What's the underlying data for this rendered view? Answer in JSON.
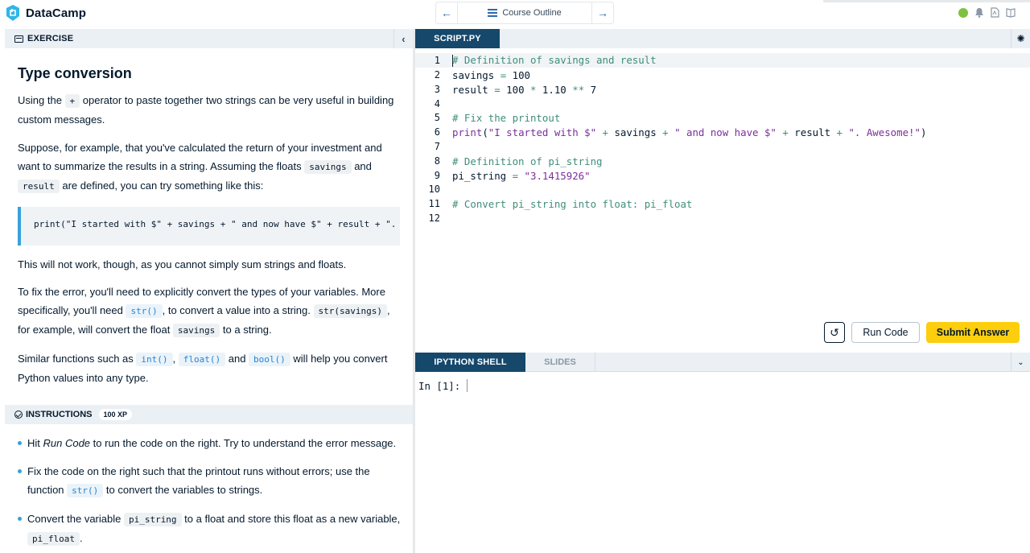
{
  "app": {
    "name": "DataCamp"
  },
  "nav": {
    "prev": "←",
    "outline": "Course Outline",
    "next": "→"
  },
  "exercise": {
    "header": "EXERCISE",
    "title": "Type conversion",
    "p1_a": "Using the ",
    "p1_code": "+",
    "p1_b": " operator to paste together two strings can be very useful in building custom messages.",
    "p2_a": "Suppose, for example, that you've calculated the return of your investment and want to summarize the results in a string. Assuming the floats ",
    "p2_code1": "savings",
    "p2_b": " and ",
    "p2_code2": "result",
    "p2_c": " are defined, you can try something like this:",
    "code_block": "print(\"I started with $\" + savings + \" and now have $\" + result + \". Awesome!\")",
    "p3": "This will not work, though, as you cannot simply sum strings and floats.",
    "p4_a": "To fix the error, you'll need to explicitly convert the types of your variables. More specifically, you'll need ",
    "p4_code1": "str()",
    "p4_b": ", to convert a value into a string. ",
    "p4_code2": "str(savings)",
    "p4_c": ", for example, will convert the float ",
    "p4_code3": "savings",
    "p4_d": " to a string.",
    "p5_a": "Similar functions such as ",
    "p5_code1": "int()",
    "p5_sep1": ", ",
    "p5_code2": "float()",
    "p5_sep2": " and ",
    "p5_code3": "bool()",
    "p5_b": " will help you convert Python values into any type."
  },
  "instructions": {
    "header": "INSTRUCTIONS",
    "xp": "100 XP",
    "i1_a": "Hit ",
    "i1_em": "Run Code",
    "i1_b": " to run the code on the right. Try to understand the error message.",
    "i2_a": "Fix the code on the right such that the printout runs without errors; use the function ",
    "i2_code": "str()",
    "i2_b": " to convert the variables to strings.",
    "i3_a": "Convert the variable ",
    "i3_code1": "pi_string",
    "i3_b": " to a float and store this float as a new variable, ",
    "i3_code2": "pi_float",
    "i3_c": "."
  },
  "editor": {
    "tab": "SCRIPT.PY",
    "line_numbers": [
      "1",
      "2",
      "3",
      "4",
      "5",
      "6",
      "7",
      "8",
      "9",
      "10",
      "11",
      "12"
    ],
    "l1": "# Definition of savings and result",
    "l2_a": "savings ",
    "l2_op": "=",
    "l2_b": " 100",
    "l3_a": "result ",
    "l3_op1": "=",
    "l3_b": " 100 ",
    "l3_op2": "*",
    "l3_c": " 1.10 ",
    "l3_op3": "**",
    "l3_d": " 7",
    "l5": "# Fix the printout",
    "l6_fn": "print",
    "l6_p1": "(",
    "l6_s1": "\"I started with $\"",
    "l6_op1": " + ",
    "l6_v1": "savings",
    "l6_op2": " + ",
    "l6_s2": "\" and now have $\"",
    "l6_op3": " + ",
    "l6_v2": "result",
    "l6_op4": " + ",
    "l6_s3": "\". Awesome!\"",
    "l6_p2": ")",
    "l8": "# Definition of pi_string",
    "l9_a": "pi_string ",
    "l9_op": "=",
    "l9_s": " \"3.1415926\"",
    "l11": "# Convert pi_string into float: pi_float"
  },
  "actions": {
    "reset": "↺",
    "run": "Run Code",
    "submit": "Submit Answer"
  },
  "shell": {
    "tab_active": "IPYTHON SHELL",
    "tab_slides": "SLIDES",
    "prompt": "In [1]:"
  }
}
